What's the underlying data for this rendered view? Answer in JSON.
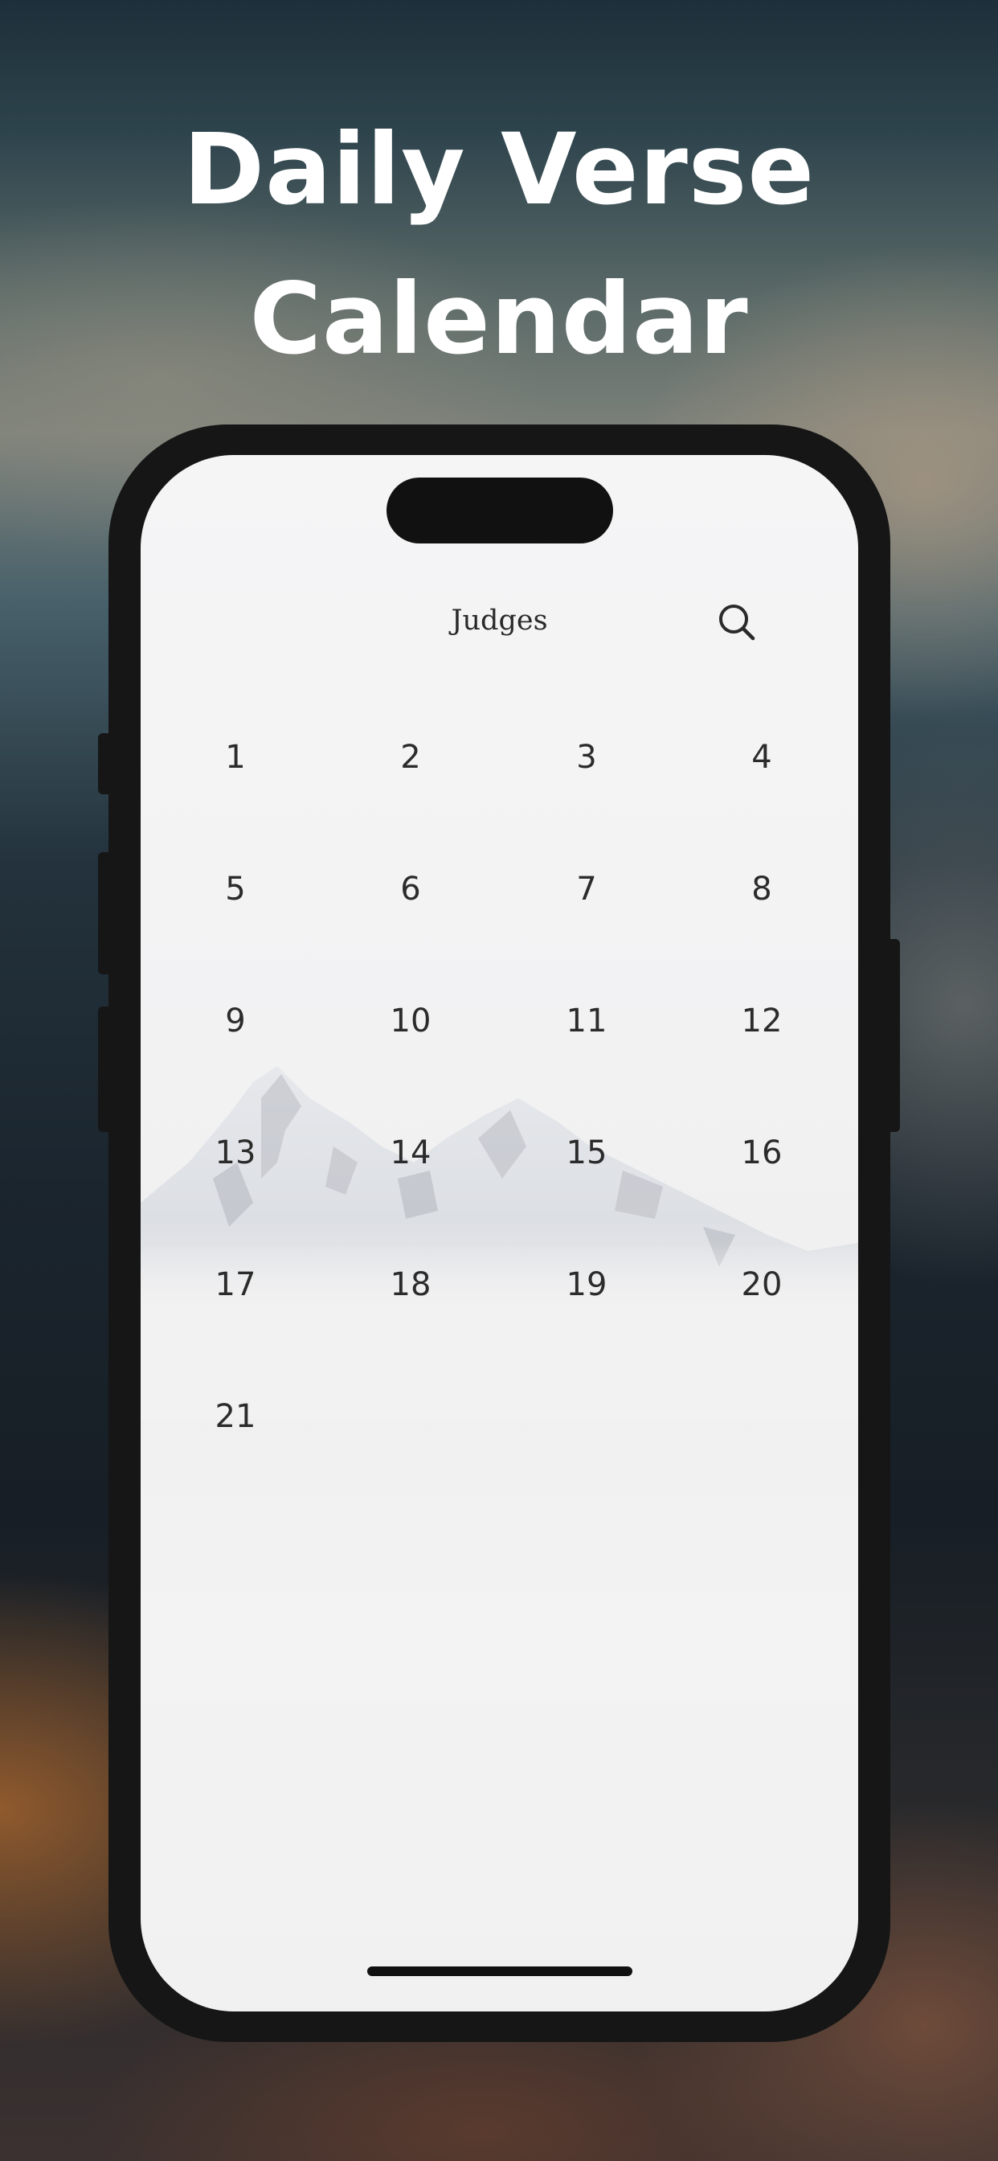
{
  "hero": {
    "title_line1": "Daily Verse",
    "title_line2": "Calendar"
  },
  "header": {
    "title": "Judges",
    "search_icon": "search-icon"
  },
  "days": [
    "1",
    "2",
    "3",
    "4",
    "5",
    "6",
    "7",
    "8",
    "9",
    "10",
    "11",
    "12",
    "13",
    "14",
    "15",
    "16",
    "17",
    "18",
    "19",
    "20",
    "21"
  ],
  "colors": {
    "text": "#2b2b2b",
    "phone_frame": "#161616",
    "screen_bg": "#f2f2f3"
  }
}
